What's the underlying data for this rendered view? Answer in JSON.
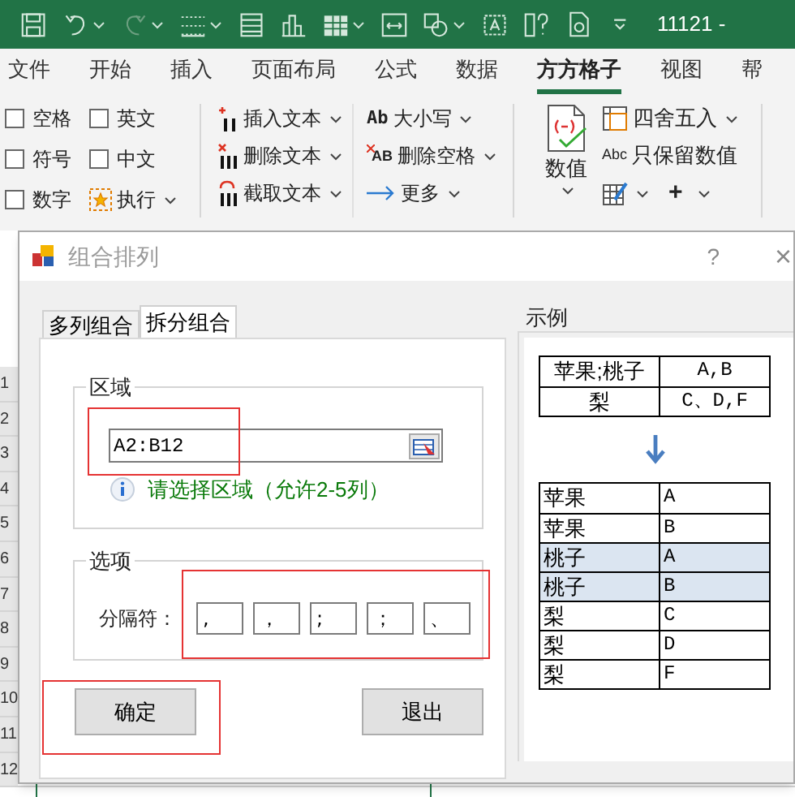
{
  "title_bar": {
    "doc_title": "11121 -"
  },
  "menu_tabs": [
    {
      "label": "文件",
      "selected": false
    },
    {
      "label": "开始",
      "selected": false
    },
    {
      "label": "插入",
      "selected": false
    },
    {
      "label": "页面布局",
      "selected": false
    },
    {
      "label": "公式",
      "selected": false
    },
    {
      "label": "数据",
      "selected": false
    },
    {
      "label": "方方格子",
      "selected": true
    },
    {
      "label": "视图",
      "selected": false
    },
    {
      "label": "帮",
      "selected": false
    }
  ],
  "ribbon": {
    "checkboxes": [
      {
        "label": "空格",
        "checked": false
      },
      {
        "label": "英文",
        "checked": false
      },
      {
        "label": "符号",
        "checked": false
      },
      {
        "label": "中文",
        "checked": false
      },
      {
        "label": "数字",
        "checked": false
      }
    ],
    "run_button": "执行",
    "text_buttons": [
      {
        "label": "插入文本",
        "kind": "insert"
      },
      {
        "label": "删除文本",
        "kind": "delete"
      },
      {
        "label": "截取文本",
        "kind": "extract"
      }
    ],
    "format_buttons": [
      {
        "label": "大小写",
        "kind": "case",
        "icon_text": "Ab"
      },
      {
        "label": "删除空格",
        "kind": "trim",
        "icon_text": "AB"
      },
      {
        "label": "更多",
        "kind": "more"
      }
    ],
    "number_button": "数值",
    "number_buttons": [
      {
        "label": "四舍五入",
        "kind": "round"
      },
      {
        "label": "只保留数值",
        "kind": "keep",
        "icon_text": "Abc"
      },
      {
        "kind": "edit"
      },
      {
        "kind": "plus",
        "icon_text": "+"
      }
    ]
  },
  "row_numbers": [
    "1",
    "2",
    "3",
    "4",
    "5",
    "6",
    "7",
    "8",
    "9",
    "10",
    "11",
    "12"
  ],
  "dialog": {
    "title": "组合排列",
    "help": "?",
    "close": "×",
    "tabs": [
      {
        "label": "多列组合",
        "selected": false
      },
      {
        "label": "拆分组合",
        "selected": true
      }
    ],
    "region": {
      "legend": "区域",
      "value": "A2:B12",
      "hint": "请选择区域（允许2-5列）"
    },
    "options": {
      "legend": "选项",
      "label": "分隔符：",
      "separators": [
        ",",
        "，",
        ";",
        "；",
        "、"
      ]
    },
    "buttons": [
      "确定",
      "退出"
    ],
    "example": {
      "legend": "示例",
      "source_rows": [
        [
          "苹果;桃子",
          "A,B"
        ],
        [
          "梨",
          "C、D,F"
        ]
      ],
      "result_rows": [
        {
          "cells": [
            "苹果",
            "A"
          ],
          "highlighted": false
        },
        {
          "cells": [
            "苹果",
            "B"
          ],
          "highlighted": false
        },
        {
          "cells": [
            "桃子",
            "A"
          ],
          "highlighted": true
        },
        {
          "cells": [
            "桃子",
            "B"
          ],
          "highlighted": true
        },
        {
          "cells": [
            "梨",
            "C"
          ],
          "highlighted": false
        },
        {
          "cells": [
            "梨",
            "D"
          ],
          "highlighted": false
        },
        {
          "cells": [
            "梨",
            "F"
          ],
          "highlighted": false
        }
      ]
    }
  }
}
